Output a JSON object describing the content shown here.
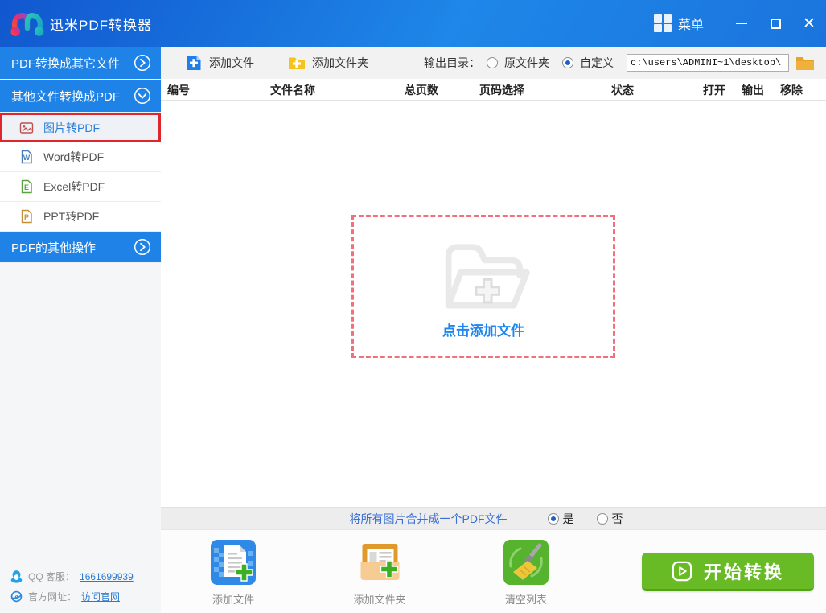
{
  "titlebar": {
    "app_title": "迅米PDF转换器",
    "menu_label": "菜单"
  },
  "sidebar": {
    "groups": [
      {
        "label": "PDF转换成其它文件",
        "state": "collapsed"
      },
      {
        "label": "其他文件转换成PDF",
        "state": "expanded"
      },
      {
        "label": "PDF的其他操作",
        "state": "collapsed"
      }
    ],
    "items": [
      {
        "label": "图片转PDF",
        "selected": true
      },
      {
        "label": "Word转PDF",
        "selected": false
      },
      {
        "label": "Excel转PDF",
        "selected": false
      },
      {
        "label": "PPT转PDF",
        "selected": false
      }
    ],
    "contact": {
      "qq_label": "QQ 客服：",
      "qq_link": "1661699939",
      "site_label": "官方网址：",
      "site_link": "访问官网"
    }
  },
  "toolbar": {
    "add_file": "添加文件",
    "add_folder": "添加文件夹",
    "output_dir_label": "输出目录：",
    "radio_original": "原文件夹",
    "radio_custom": "自定义",
    "custom_selected": true,
    "path_value": "c:\\users\\ADMINI~1\\desktop\\"
  },
  "table": {
    "headers": [
      "编号",
      "文件名称",
      "总页数",
      "页码选择",
      "状态",
      "打开",
      "输出",
      "移除"
    ]
  },
  "dropzone": {
    "label": "点击添加文件"
  },
  "merge_bar": {
    "label": "将所有图片合并成一个PDF文件",
    "yes": "是",
    "no": "否",
    "selected": "是"
  },
  "bottom": {
    "add_file": "添加文件",
    "add_folder": "添加文件夹",
    "clear_list": "清空列表",
    "start": "开始转换"
  },
  "colors": {
    "titlebar_blue": "#1e87e8",
    "sidebar_header_blue": "#1e82e6",
    "selected_border_red": "#e0262c",
    "dropzone_dash_pink": "#f2707e",
    "start_green": "#68bb25",
    "link_blue": "#2a7bd0"
  }
}
